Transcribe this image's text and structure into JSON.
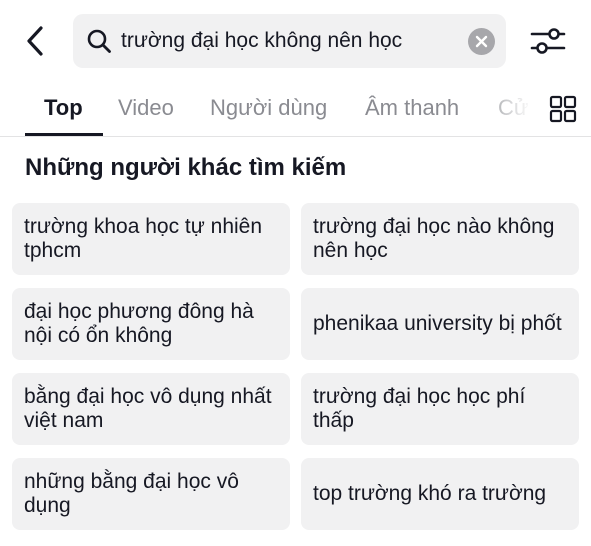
{
  "search": {
    "query": "trường đại học không nên học",
    "icon": "search-icon"
  },
  "header": {
    "back_icon": "back-arrow-icon",
    "clear_icon": "clear-icon",
    "filter_icon": "filter-sliders-icon"
  },
  "tabs": [
    {
      "label": "Top",
      "active": true
    },
    {
      "label": "Video",
      "active": false
    },
    {
      "label": "Người dùng",
      "active": false
    },
    {
      "label": "Âm thanh",
      "active": false
    },
    {
      "label": "Cử",
      "active": false
    }
  ],
  "grid_icon": "grid-view-icon",
  "section": {
    "title": "Những người khác tìm kiếm"
  },
  "suggestions": [
    {
      "label": "trường khoa học tự nhiên tphcm"
    },
    {
      "label": "trường đại học nào không nên học"
    },
    {
      "label": "đại học phương đông hà nội có ổn không"
    },
    {
      "label": "phenikaa university bị phốt"
    },
    {
      "label": "bằng đại học vô dụng nhất việt nam"
    },
    {
      "label": "trường đại học học phí thấp"
    },
    {
      "label": "những bằng đại học vô dụng"
    },
    {
      "label": "top trường khó ra trường"
    }
  ],
  "colors": {
    "text_primary": "#161823",
    "text_secondary": "#8a8b91",
    "surface": "#f1f1f2",
    "clear_button": "#a7a7ab"
  }
}
